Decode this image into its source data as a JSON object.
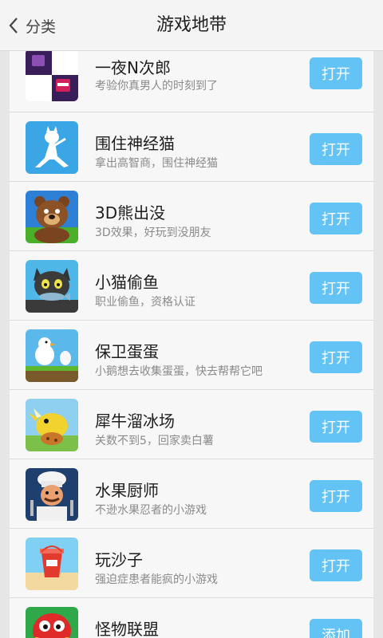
{
  "header": {
    "back_label": "分类",
    "title": "游戏地带"
  },
  "games": [
    {
      "name": "一夜N次郎",
      "desc": "考验你真男人的时刻到了",
      "action": "打开",
      "icon": "checkerboard-icon"
    },
    {
      "name": "围住神经猫",
      "desc": "拿出高智商，围住神经猫",
      "action": "打开",
      "icon": "white-cat-icon"
    },
    {
      "name": "3D熊出没",
      "desc": "3D效果，好玩到没朋友",
      "action": "打开",
      "icon": "bear-icon"
    },
    {
      "name": "小猫偷鱼",
      "desc": "职业偷鱼，资格认证",
      "action": "打开",
      "icon": "black-cat-icon"
    },
    {
      "name": "保卫蛋蛋",
      "desc": "小鹅想去收集蛋蛋，快去帮帮它吧",
      "action": "打开",
      "icon": "goose-egg-icon"
    },
    {
      "name": "犀牛溜冰场",
      "desc": "关数不到5，回家卖白薯",
      "action": "打开",
      "icon": "rhino-icon"
    },
    {
      "name": "水果厨师",
      "desc": "不逊水果忍者的小游戏",
      "action": "打开",
      "icon": "chef-icon"
    },
    {
      "name": "玩沙子",
      "desc": "强迫症患者能疯的小游戏",
      "action": "打开",
      "icon": "sand-bucket-icon"
    },
    {
      "name": "怪物联盟",
      "desc": "",
      "action": "添加",
      "icon": "monster-icon"
    }
  ]
}
